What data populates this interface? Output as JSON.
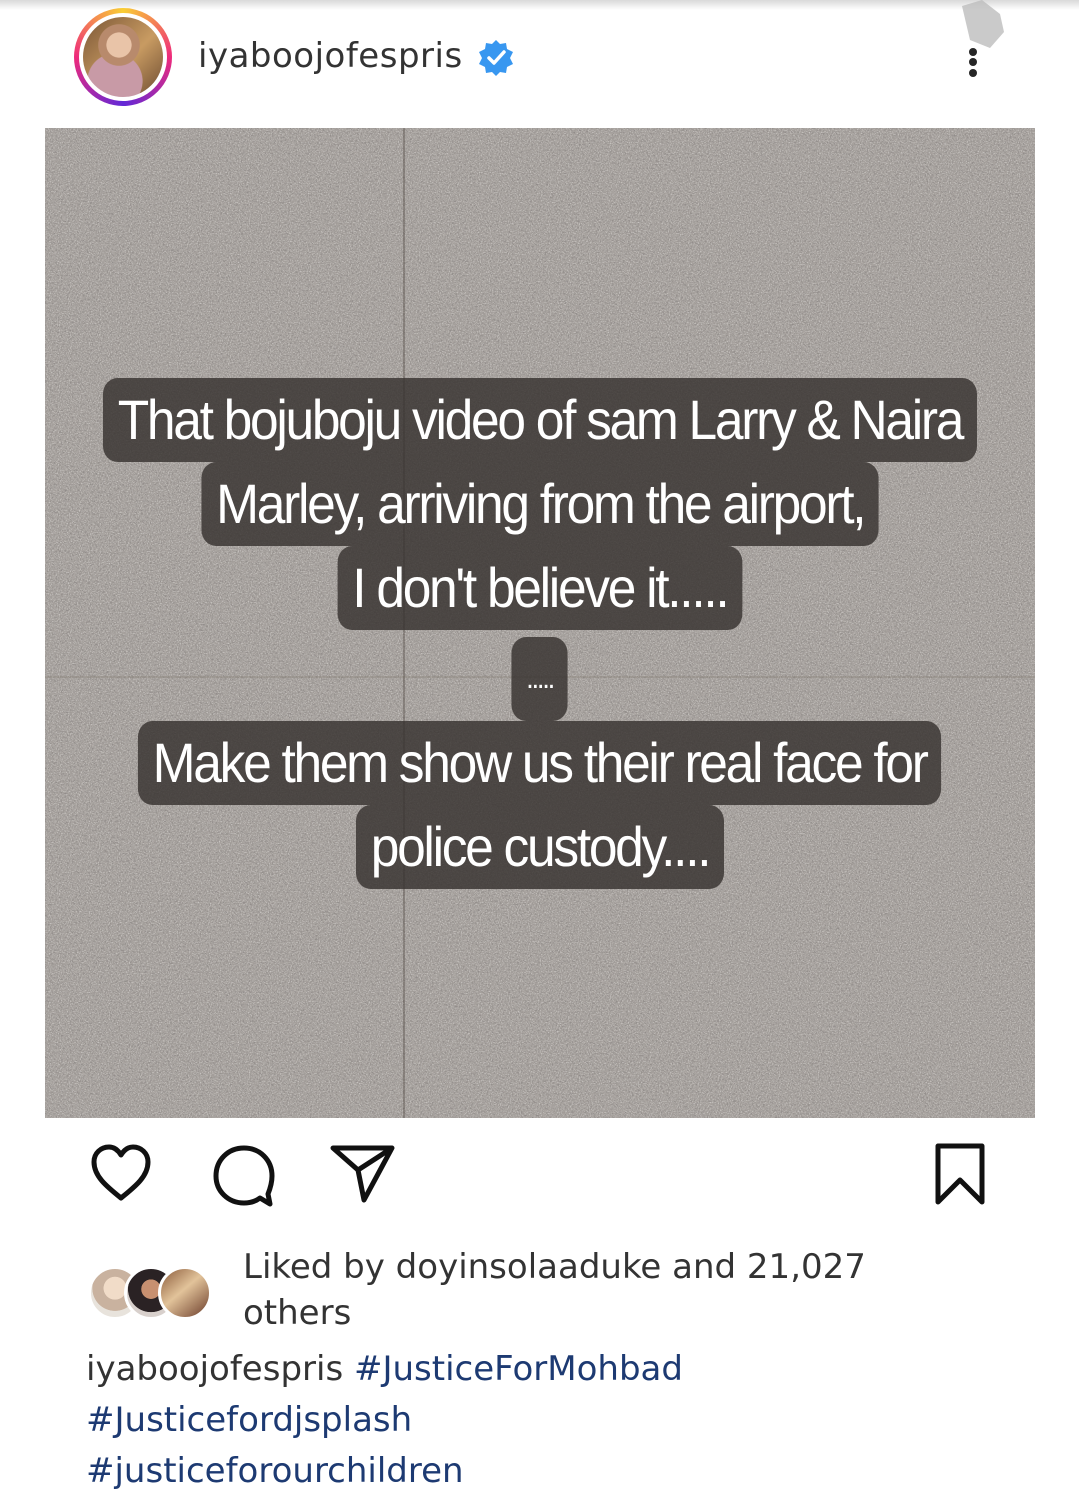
{
  "post": {
    "username": "iyaboojofespris",
    "verified": true,
    "icons": {
      "avatar": "profile-photo",
      "verified": "verified-badge-icon",
      "more": "more-options-icon"
    },
    "story_lines": [
      "That bojuboju video of sam Larry & Naira",
      "Marley, arriving from the airport,",
      "I don't believe it.....",
      ".....",
      "Make them show us their real face for",
      "police custody...."
    ],
    "actions": {
      "like": "heart-icon",
      "comment": "comment-icon",
      "share": "share-icon",
      "save": "bookmark-icon"
    },
    "likes_text": "Liked by doyinsolaaduke and 21,027 others",
    "caption": {
      "username": "iyaboojofespris",
      "hashtags": [
        "#JusticeForMohbad",
        "#Justicefordjsplash",
        "#justiceforourchildren"
      ]
    },
    "colors": {
      "hashtag": "#1d3a72",
      "verified": "#3897f0",
      "text": "#262626"
    }
  }
}
